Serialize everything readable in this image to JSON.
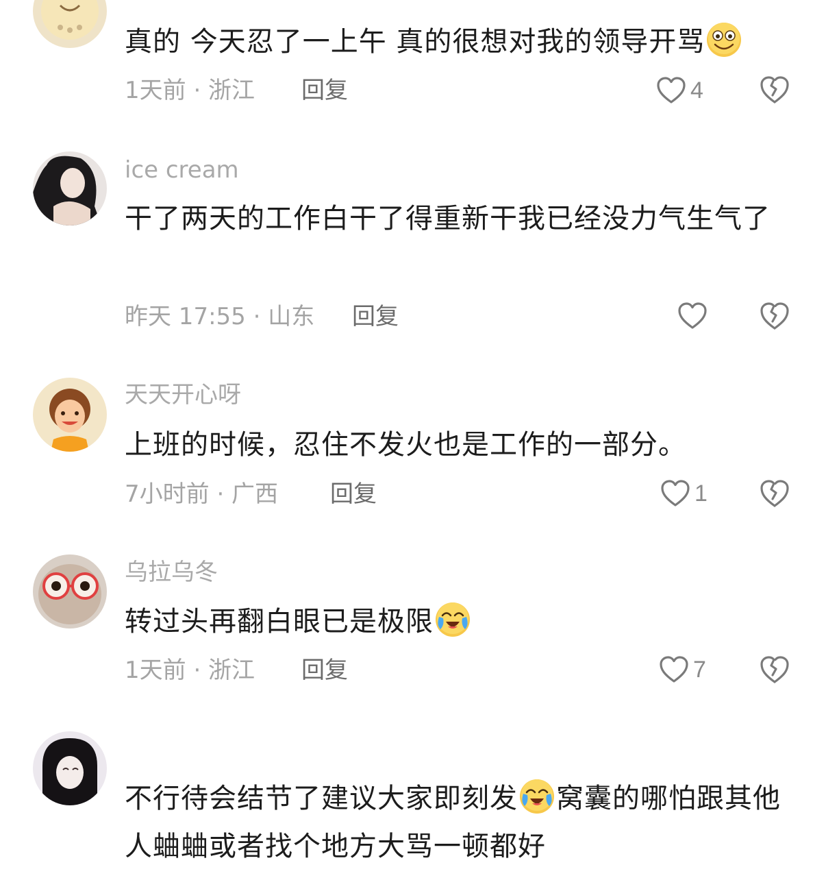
{
  "comments": [
    {
      "username": "",
      "text": "真的 今天忍了一上午 真的很想对我的领导开骂",
      "emoji": "grin-emoji",
      "time": "1天前 · 浙江",
      "reply": "回复",
      "likes": "4"
    },
    {
      "username": "ice cream",
      "text": "干了两天的工作白干了得重新干我已经没力气生气了",
      "time": "昨天 17:55 · 山东",
      "reply": "回复",
      "likes": ""
    },
    {
      "username": "天天开心呀",
      "text": "上班的时候，忍住不发火也是工作的一部分。",
      "time": "7小时前 · 广西",
      "reply": "回复",
      "likes": "1"
    },
    {
      "username": "乌拉乌冬",
      "text": "转过头再翻白眼已是极限",
      "emoji": "crying-laughing-emoji",
      "time": "1天前 · 浙江",
      "reply": "回复",
      "likes": "7"
    },
    {
      "username": "",
      "text_part1": "不行待会结节了建议大家即刻发",
      "emoji": "crying-laughing-emoji",
      "text_part2": "窝囊的哪怕跟其他人蛐蛐或者找个地方大骂一顿都好"
    }
  ],
  "colors": {
    "text": "#1c1c1c",
    "meta": "#a4a4a4",
    "reply": "#6b6b6b",
    "icon": "#7a7a7a"
  },
  "icons": [
    "heart-outline-icon",
    "broken-heart-icon"
  ]
}
